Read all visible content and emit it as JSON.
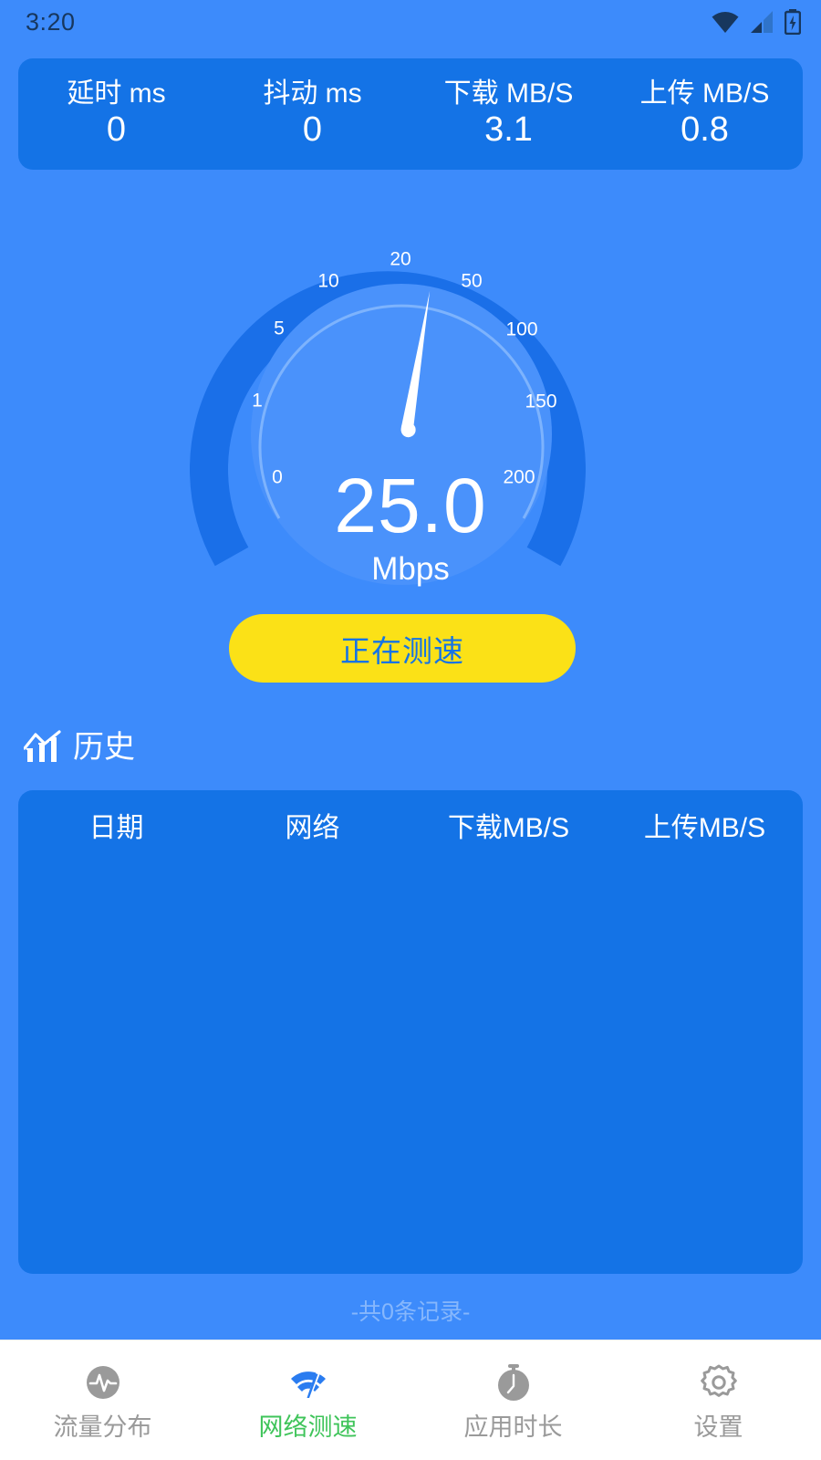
{
  "statusbar": {
    "time": "3:20",
    "icons": [
      "wifi-icon",
      "cell-signal-icon",
      "battery-charging-icon"
    ]
  },
  "metrics": {
    "items": [
      {
        "label": "延时 ms",
        "value": "0"
      },
      {
        "label": "抖动 ms",
        "value": "0"
      },
      {
        "label": "下载 MB/S",
        "value": "3.1"
      },
      {
        "label": "上传 MB/S",
        "value": "0.8"
      }
    ]
  },
  "gauge": {
    "value": "25.0",
    "unit": "Mbps",
    "ticks": [
      "0",
      "1",
      "5",
      "10",
      "20",
      "50",
      "100",
      "150",
      "200"
    ]
  },
  "action": {
    "test_label": "正在测速"
  },
  "history": {
    "icon": "line-chart-icon",
    "title": "历史",
    "columns": [
      "日期",
      "网络",
      "下载MB/S",
      "上传MB/S"
    ],
    "rows": [],
    "record_count_text": "-共0条记录-"
  },
  "bottom_nav": {
    "items": [
      {
        "label": "流量分布",
        "icon": "traffic-pulse-icon",
        "active": false
      },
      {
        "label": "网络测速",
        "icon": "speedtest-icon",
        "active": true
      },
      {
        "label": "应用时长",
        "icon": "stopwatch-icon",
        "active": false
      },
      {
        "label": "设置",
        "icon": "gear-icon",
        "active": false
      }
    ]
  },
  "colors": {
    "background": "#3d8bfb",
    "card": "#1473e6",
    "accent_yellow": "#fbe117",
    "accent_green": "#3fc45a",
    "ring": "#1a6fe8",
    "text_white": "#ffffff"
  },
  "chart_data": {
    "type": "gauge",
    "title": "Network speed gauge",
    "value": 25.0,
    "unit": "Mbps",
    "tick_values": [
      0,
      1,
      5,
      10,
      20,
      50,
      100,
      150,
      200
    ],
    "min": 0,
    "max": 200,
    "scale": "nonlinear-log-like",
    "needle_position_label": "20-50"
  }
}
